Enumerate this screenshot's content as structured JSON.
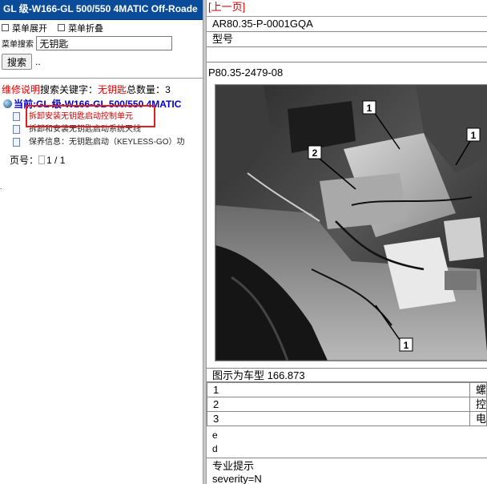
{
  "left": {
    "title": "GL 级-W166-GL 500/550 4MATIC Off-Roade",
    "menu": {
      "expand": "菜单展开",
      "collapse": "菜单折叠"
    },
    "search": {
      "label": "菜单搜索",
      "value": "无钥匙",
      "button": "搜索",
      "dots": ".."
    },
    "info": {
      "prefix": "维修说明",
      "kw_label": "搜索关键字：",
      "keyword": "无钥匙",
      "count_label": "总数量：",
      "count": "3"
    },
    "tree": {
      "root": "当前:GL 级-W166-GL 500/550 4MATIC",
      "items": [
        "拆卸安装无钥匙启动控制单元",
        "拆卸和安装无钥匙启动系统天线",
        "保养信息：无钥匙启动（KEYLESS-GO）功"
      ]
    },
    "pager": {
      "label": "页号：",
      "value": "1 / 1"
    },
    "tiny": "."
  },
  "right": {
    "prev": "[上一页]",
    "doc_id": "AR80.35-P-0001GQA",
    "model_label": "型号",
    "part_no": "P80.35-2479-08",
    "caption": "图示为车型 166.873",
    "parts": [
      {
        "num": "1",
        "desc": "螺"
      },
      {
        "num": "2",
        "desc": "控"
      },
      {
        "num": "3",
        "desc": "电"
      }
    ],
    "notes": [
      "e",
      "d"
    ],
    "tip_title": "专业提示",
    "tip_line": "severity=N",
    "callouts": [
      "1",
      "1",
      "2",
      "1"
    ]
  }
}
